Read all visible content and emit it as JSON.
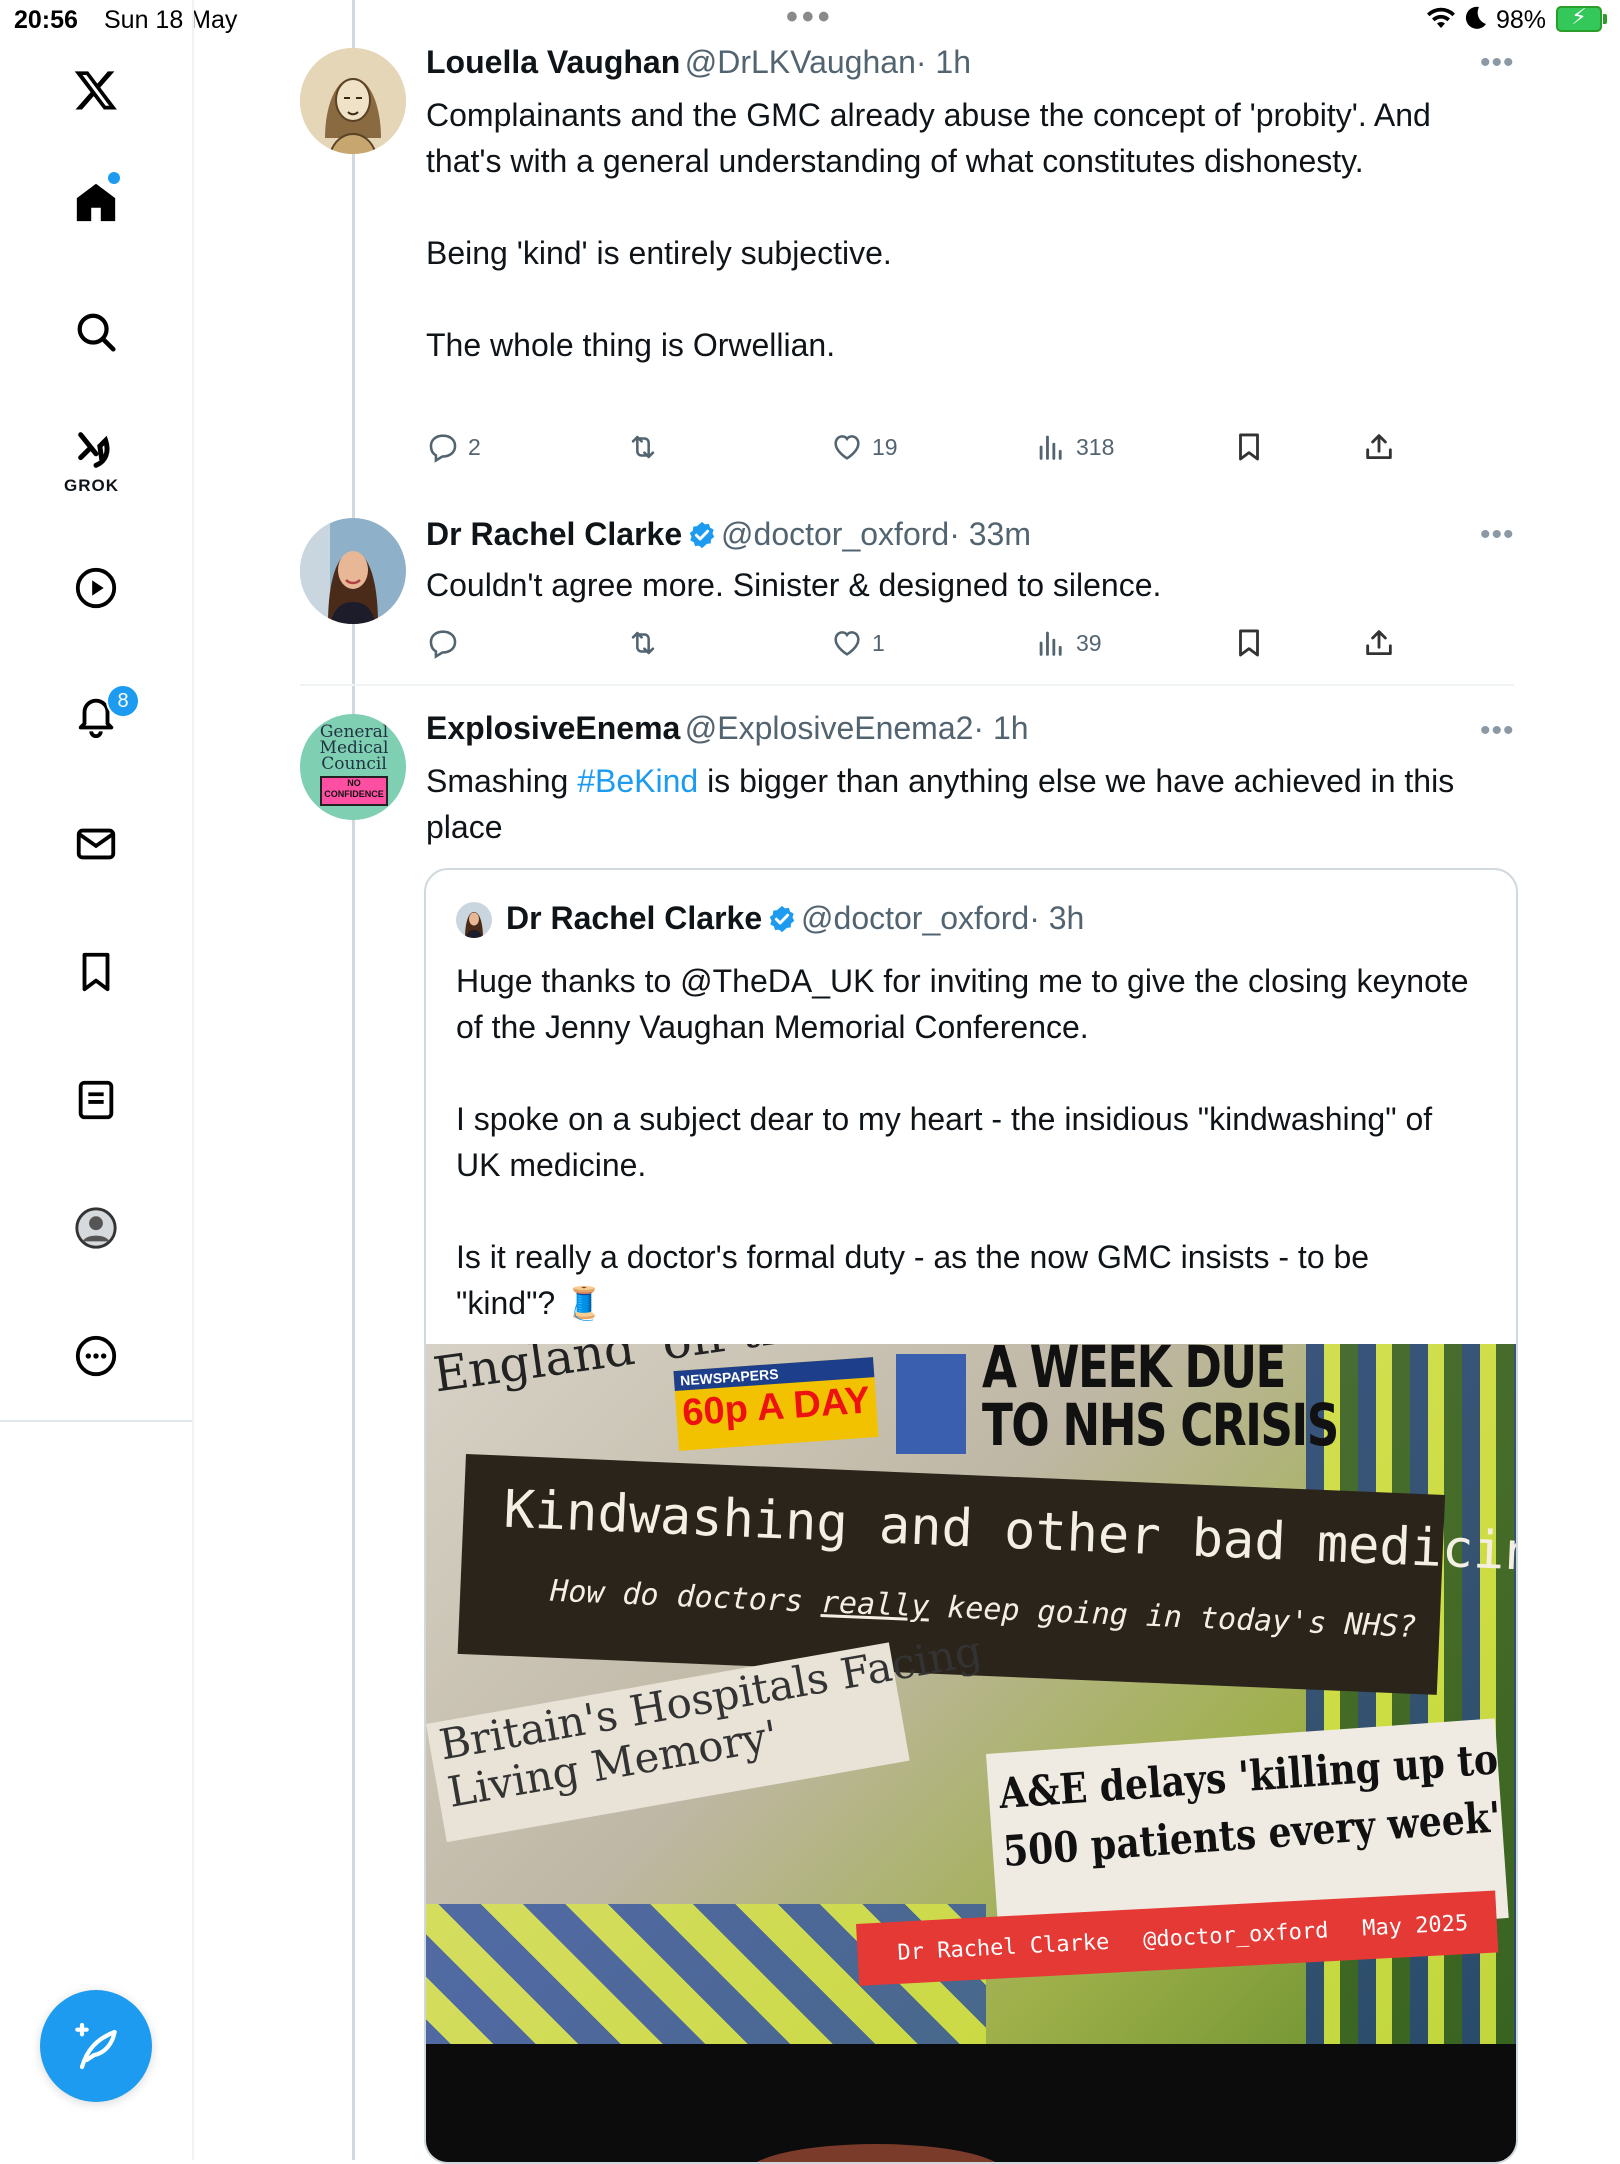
{
  "status_bar": {
    "time": "20:56",
    "date": "Sun 18 May",
    "battery": "98%"
  },
  "sidebar": {
    "grok_label": "GROK",
    "notification_count": "8"
  },
  "tweets": [
    {
      "name": "Louella Vaughan",
      "handle": "@DrLKVaughan",
      "time": "· 1h",
      "paragraphs": [
        "Complainants and the GMC already abuse the concept of 'probity'. And that's with a general understanding of what constitutes dishonesty.",
        "Being 'kind' is entirely subjective.",
        "The whole thing is Orwellian."
      ],
      "replies": "2",
      "retweets": "",
      "likes": "19",
      "views": "318"
    },
    {
      "name": "Dr Rachel Clarke",
      "handle": "@doctor_oxford",
      "time": "· 33m",
      "text": "Couldn't agree more. Sinister & designed to silence.",
      "replies": "",
      "retweets": "",
      "likes": "1",
      "views": "39"
    },
    {
      "name": "ExplosiveEnema",
      "handle": "@ExplosiveEnema2",
      "time": "· 1h",
      "text_before": "Smashing ",
      "hashtag": "#BeKind",
      "text_after": " is bigger than anything else we have achieved in this place",
      "avatar_text": [
        "General",
        "Medical",
        "Council",
        "NO",
        "CONFIDENCE"
      ],
      "quote": {
        "name": "Dr Rachel Clarke",
        "handle": "@doctor_oxford",
        "time": "· 3h",
        "paragraphs": [
          "Huge thanks to @TheDA_UK for inviting me to give the closing keynote of the Jenny Vaughan Memorial Conference.",
          "I spoke on a subject dear to my heart - the insidious \"kindwashing\" of UK medicine.",
          "Is it really a doctor's formal duty - as the now GMC insists - to be \"kind\"? 🧵"
        ],
        "image": {
          "headline_top_left": "England 'off the",
          "price_badge": "60p A DAY",
          "newspapers": "NEWSPAPERS",
          "headline_top_right_1": "A WEEK DUE",
          "headline_top_right_2": "TO NHS CRISIS",
          "slide_title": "Kindwashing and other bad medicine",
          "slide_subtitle_1": "How do doctors ",
          "slide_subtitle_underlined": "really",
          "slide_subtitle_2": " keep going in today's NHS?",
          "headline_mid_left_1": "Britain's Hospitals Facing",
          "headline_mid_left_2": "Living Memory'",
          "headline_mid_right_1": "A&E delays 'killing up to",
          "headline_mid_right_2": "500 patients every week'",
          "footer_name": "Dr Rachel Clarke",
          "footer_handle": "@doctor_oxford",
          "footer_date": "May 2025"
        }
      }
    }
  ],
  "colors": {
    "accent": "#1d9bf0",
    "text": "#0f1419",
    "muted": "#536471",
    "slide_red": "#e53935"
  },
  "icons": [
    "x-logo-icon",
    "home-icon",
    "search-icon",
    "grok-icon",
    "video-icon",
    "bell-icon",
    "mail-icon",
    "bookmark-icon",
    "list-icon",
    "profile-icon",
    "more-icon",
    "compose-icon",
    "reply-icon",
    "retweet-icon",
    "like-icon",
    "views-icon",
    "share-icon",
    "verified-icon"
  ]
}
